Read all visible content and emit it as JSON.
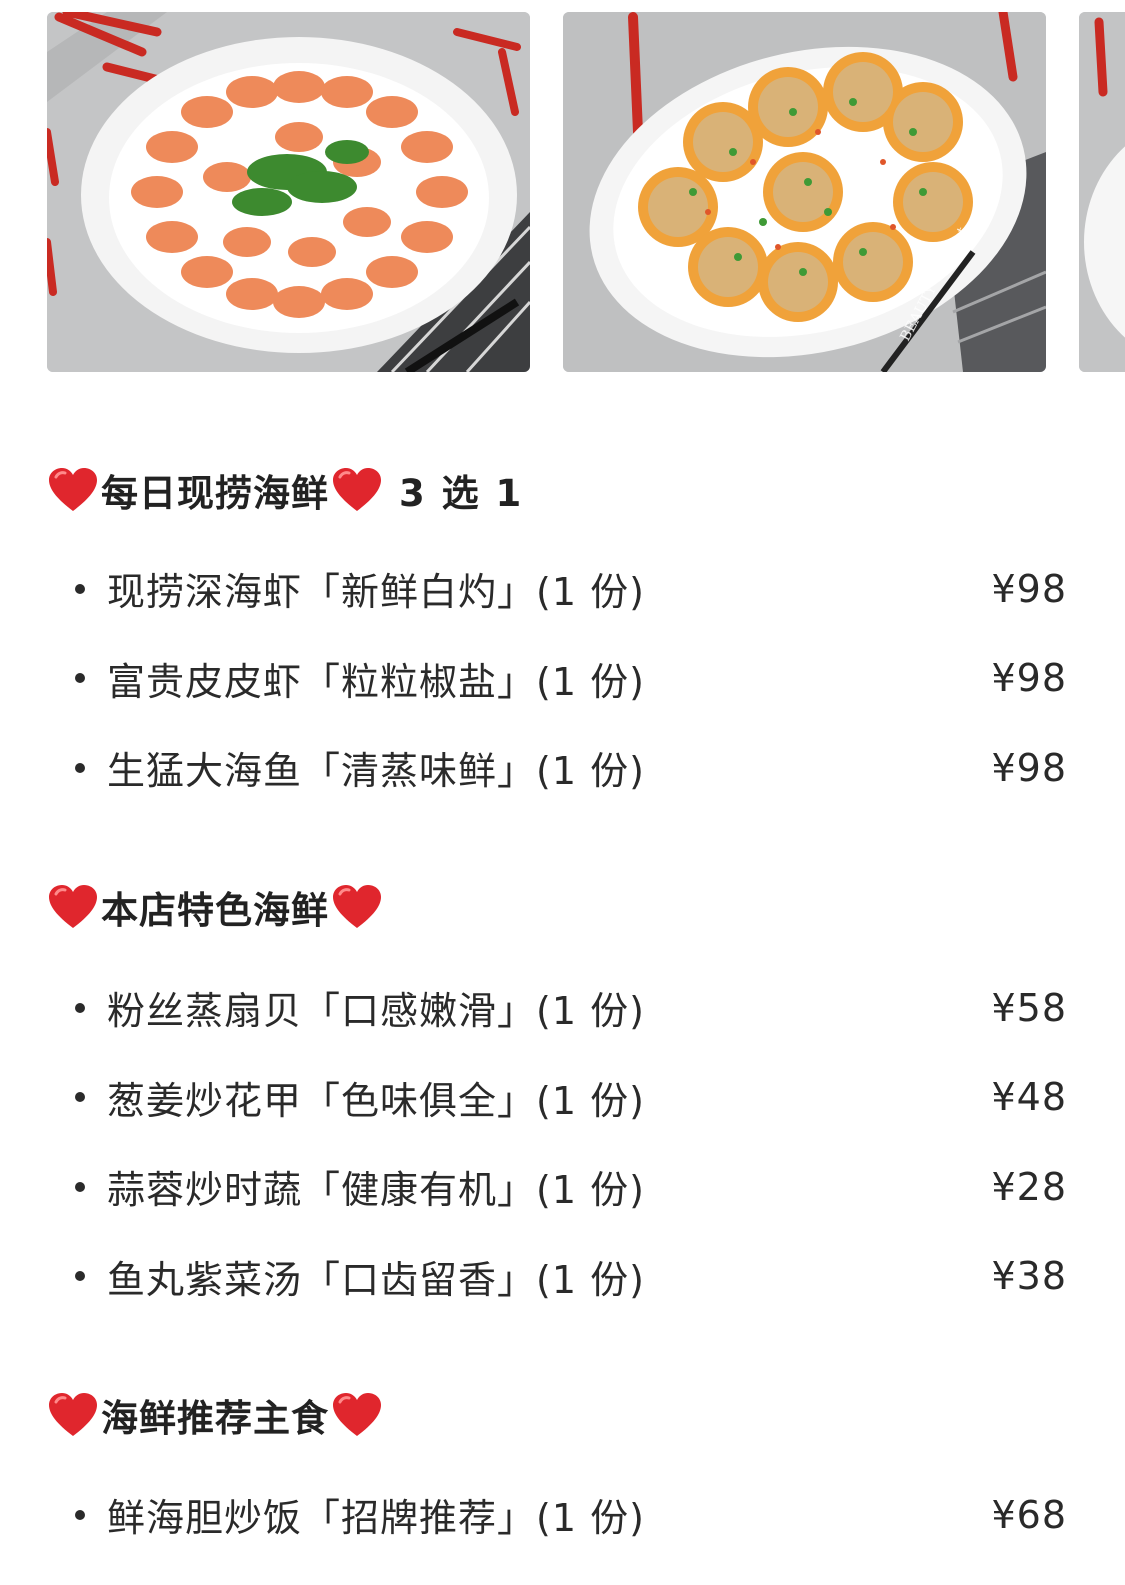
{
  "sections": [
    {
      "title": "每日现捞海鲜",
      "extra": "3 选 1",
      "items": [
        {
          "name": "现捞深海虾「新鲜白灼」(1 份)",
          "price": "¥98"
        },
        {
          "name": "富贵皮皮虾「粒粒椒盐」(1 份)",
          "price": "¥98"
        },
        {
          "name": "生猛大海鱼「清蒸味鲜」(1 份)",
          "price": "¥98"
        }
      ]
    },
    {
      "title": "本店特色海鲜",
      "items": [
        {
          "name": "粉丝蒸扇贝「口感嫩滑」(1 份)",
          "price": "¥58"
        },
        {
          "name": "葱姜炒花甲「色味俱全」(1 份)",
          "price": "¥48"
        },
        {
          "name": "蒜蓉炒时蔬「健康有机」(1 份)",
          "price": "¥28"
        },
        {
          "name": "鱼丸紫菜汤「口齿留香」(1 份)",
          "price": "¥38"
        }
      ]
    },
    {
      "title": "海鲜推荐主食",
      "items": [
        {
          "name": "鲜海胆炒饭「招牌推荐」(1 份)",
          "price": "¥68"
        }
      ]
    }
  ],
  "photo_watermark": "BEAUTY GET lost",
  "colors": {
    "heart": "#e0262d",
    "text": "#222222",
    "background": "#ffffff"
  }
}
